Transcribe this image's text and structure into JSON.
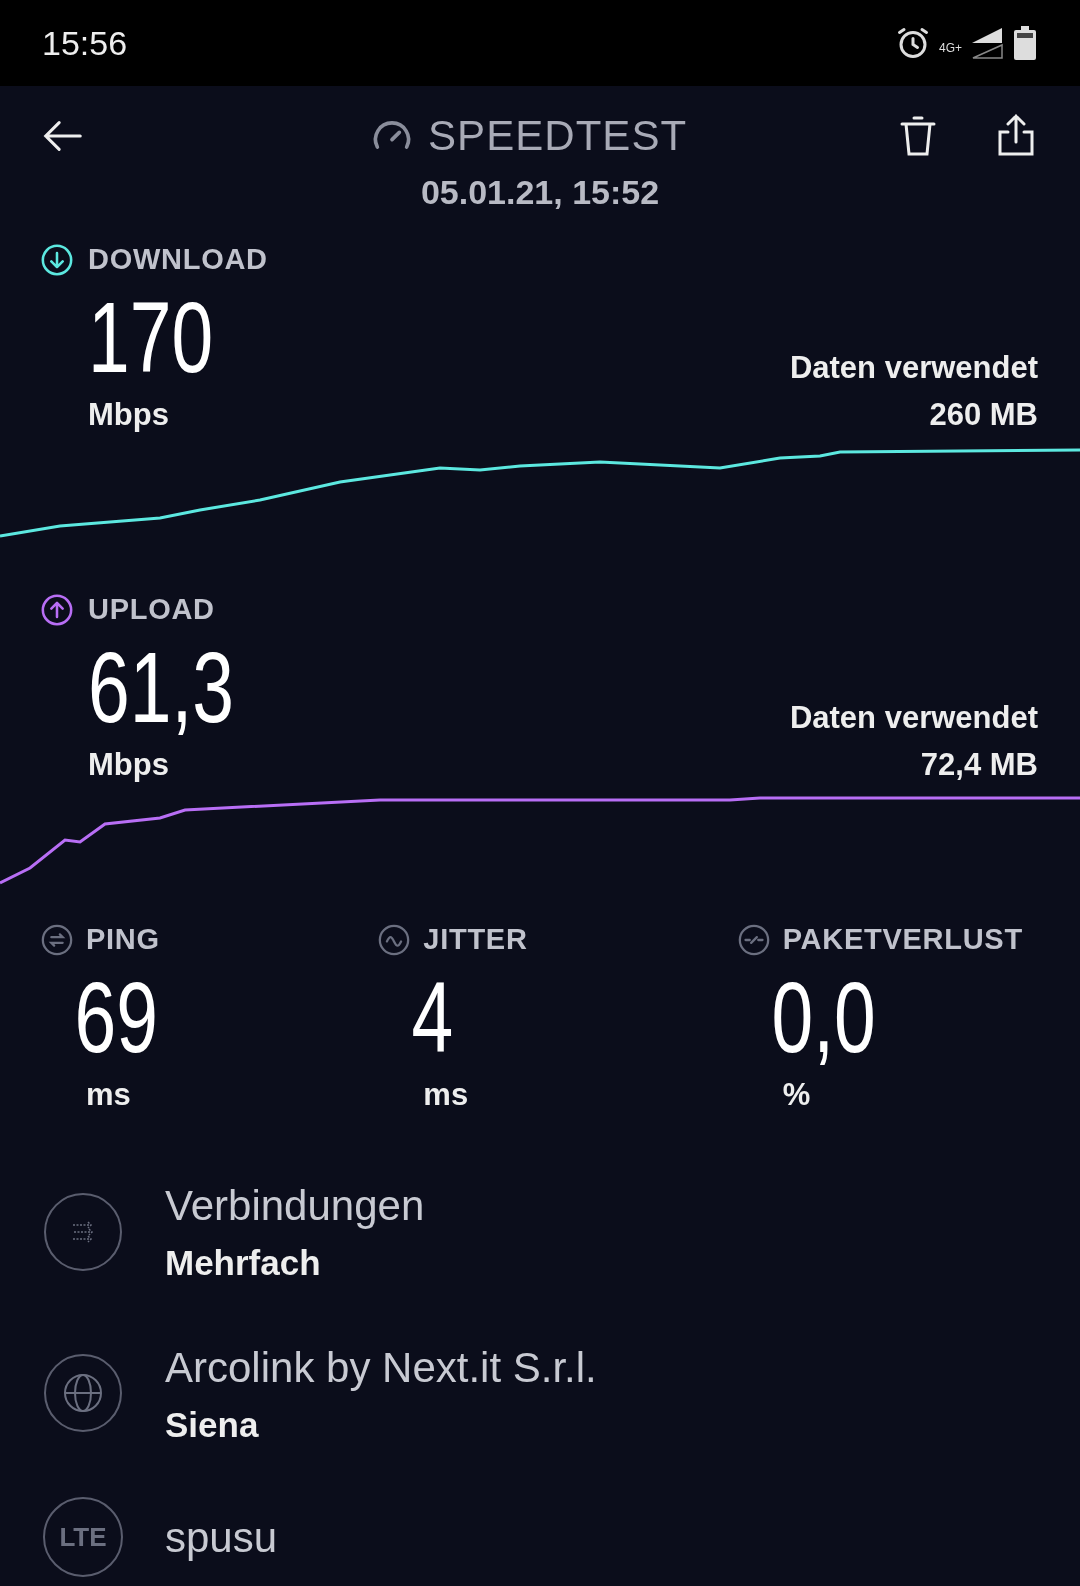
{
  "status_bar": {
    "time": "15:56",
    "network": "4G+"
  },
  "header": {
    "title": "SPEEDTEST",
    "date": "05.01.21, 15:52"
  },
  "results": [
    {
      "kind": "download",
      "label": "DOWNLOAD",
      "value": "170",
      "unit": "Mbps",
      "data_label": "Daten verwendet",
      "data_value": "260 MB",
      "color": "#5ce8e0"
    },
    {
      "kind": "upload",
      "label": "UPLOAD",
      "value": "61,3",
      "unit": "Mbps",
      "data_label": "Daten verwendet",
      "data_value": "72,4 MB",
      "color": "#b86ef5"
    }
  ],
  "metrics": [
    {
      "kind": "ping",
      "label": "PING",
      "value": "69",
      "unit": "ms"
    },
    {
      "kind": "jitter",
      "label": "JITTER",
      "value": "4",
      "unit": "ms"
    },
    {
      "kind": "loss",
      "label": "PAKETVERLUST",
      "value": "0,0",
      "unit": "%"
    }
  ],
  "details": [
    {
      "kind": "connections",
      "title": "Verbindungen",
      "subtitle": "Mehrfach"
    },
    {
      "kind": "server",
      "title": "Arcolink by Next.it S.r.l.",
      "subtitle": "Siena"
    },
    {
      "kind": "network",
      "badge": "LTE",
      "title": "spusu"
    }
  ]
}
